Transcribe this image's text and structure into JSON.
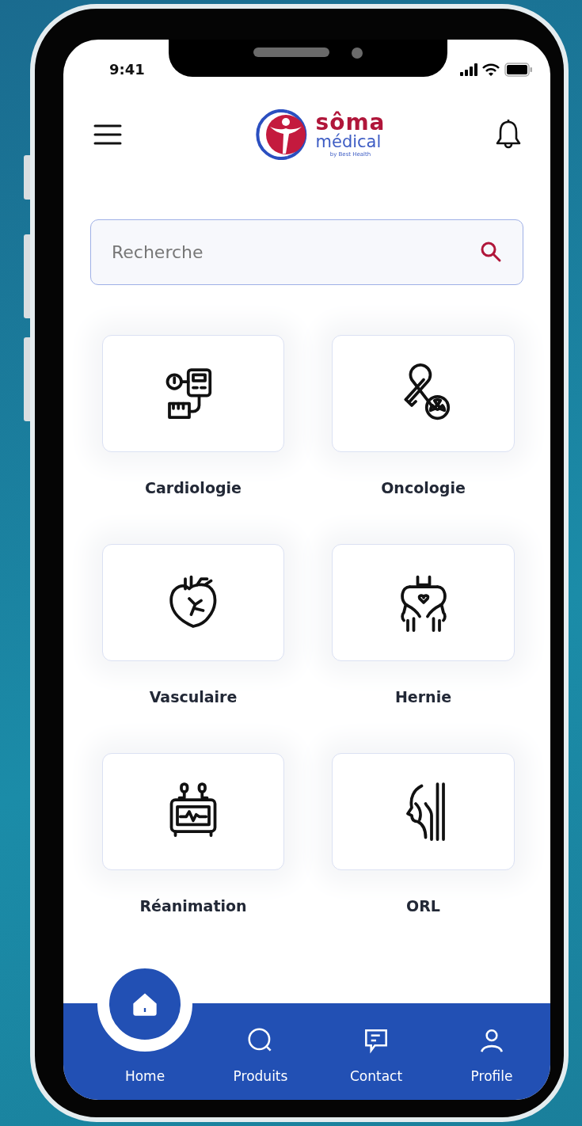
{
  "status_bar": {
    "time": "9:41"
  },
  "header": {
    "logo": {
      "name": "sôma",
      "subtitle": "médical",
      "tagline": "by Best Health"
    }
  },
  "search": {
    "placeholder": "Recherche"
  },
  "categories": [
    {
      "label": "Cardiologie"
    },
    {
      "label": "Oncologie"
    },
    {
      "label": "Vasculaire"
    },
    {
      "label": "Hernie"
    },
    {
      "label": "Réanimation"
    },
    {
      "label": "ORL"
    }
  ],
  "nav": [
    {
      "label": "Home",
      "selected": true
    },
    {
      "label": "Produits",
      "selected": false
    },
    {
      "label": "Contact",
      "selected": false
    },
    {
      "label": "Profile",
      "selected": false
    }
  ]
}
